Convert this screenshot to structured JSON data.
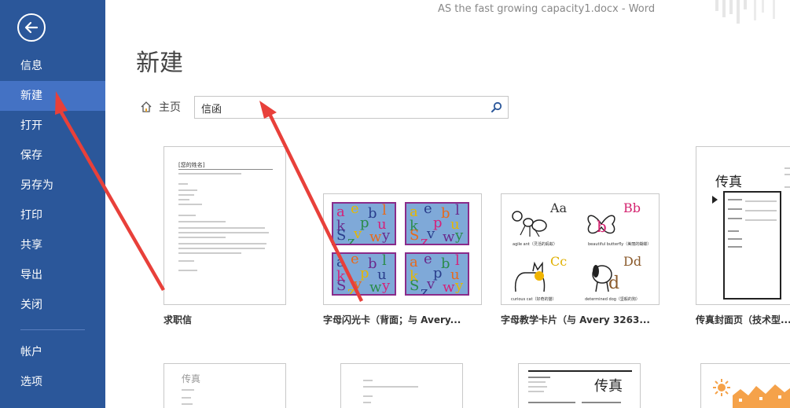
{
  "window_title": "AS the fast growing capacity1.docx - Word",
  "sidebar": {
    "items": [
      {
        "label": "信息"
      },
      {
        "label": "新建"
      },
      {
        "label": "打开"
      },
      {
        "label": "保存"
      },
      {
        "label": "另存为"
      },
      {
        "label": "打印"
      },
      {
        "label": "共享"
      },
      {
        "label": "导出"
      },
      {
        "label": "关闭"
      },
      {
        "label": "帐户"
      },
      {
        "label": "选项"
      }
    ],
    "active": "新建"
  },
  "page": {
    "title": "新建",
    "home_label": "主页",
    "search_value": "信函"
  },
  "templates": [
    {
      "label": "求职信",
      "thumb_title": "[您的姓名]"
    },
    {
      "label": "字母闪光卡（背面；与 Avery..."
    },
    {
      "label": "字母教学卡片（与 Avery 3263...",
      "cards": [
        {
          "letters": "Aa",
          "caption": "agile ant（灵活的蚂蚁）"
        },
        {
          "letters": "Bb",
          "caption": "beautiful butterfly（美丽的蝴蝶）"
        },
        {
          "letters": "Cc",
          "caption": "curious cat（好奇的猫）"
        },
        {
          "letters": "Dd",
          "caption": "determined dog（坚毅的狗）"
        }
      ]
    },
    {
      "label": "传真封面页（技术型...",
      "thumb_title": "传真"
    },
    {
      "thumb_title": "传真"
    },
    {
      "thumb_title": ""
    },
    {
      "thumb_title": "传真"
    },
    {
      "thumb_title": ""
    }
  ],
  "flash_letters": [
    "a",
    "e",
    "b",
    "l",
    "k",
    "p",
    "u",
    "v",
    "S",
    "w",
    "y",
    "z"
  ],
  "colors": {
    "sidebar_bg": "#2b579a",
    "sidebar_active": "#4472c4",
    "annotation_arrow": "#e8403a"
  }
}
